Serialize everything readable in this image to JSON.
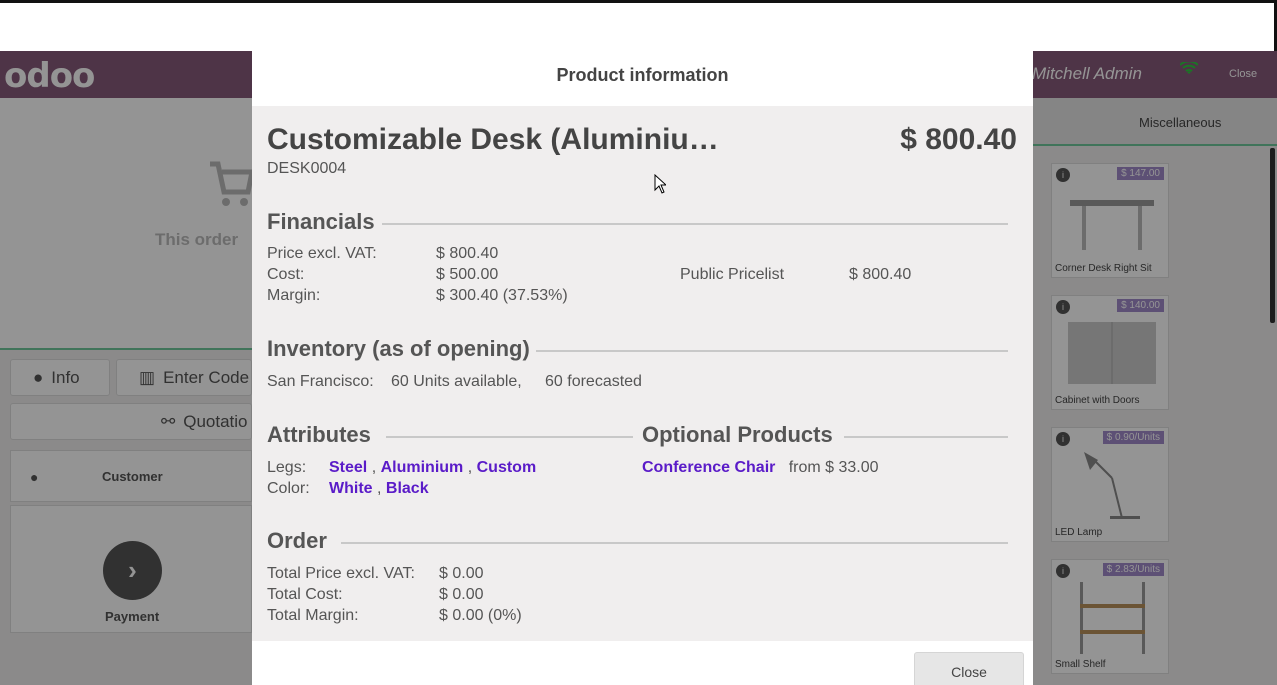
{
  "pos": {
    "logo": "odoo",
    "user": "Mitchell Admin",
    "close": "Close",
    "category": "Miscellaneous",
    "empty_cart": "This order",
    "info_button": "Info",
    "enter_code_button": "Enter Code",
    "quotation_button": "Quotatio",
    "customer_label": "Customer",
    "payment_label": "Payment",
    "products": [
      {
        "name": "Corner Desk Right Sit",
        "price": "$ 147.00"
      },
      {
        "name": "Cabinet with Doors",
        "price": "$ 140.00"
      },
      {
        "name": "LED Lamp",
        "price": "$ 0.90/Units"
      },
      {
        "name": "Small Shelf",
        "price": "$ 2.83/Units"
      }
    ]
  },
  "modal": {
    "title": "Product information",
    "product_name": "Customizable Desk (Aluminiu…",
    "product_price": "$ 800.40",
    "product_ref": "DESK0004",
    "financials": {
      "title": "Financials",
      "price_label": "Price excl. VAT:",
      "price_value": "$ 800.40",
      "cost_label": "Cost:",
      "cost_value": "$ 500.00",
      "margin_label": "Margin:",
      "margin_value": "$ 300.40 (37.53%)",
      "pricelist_name": "Public Pricelist",
      "pricelist_value": "$ 800.40"
    },
    "inventory": {
      "title": "Inventory (as of opening)",
      "warehouse": "San Francisco:",
      "available": "60 Units available,",
      "forecasted": "60 forecasted"
    },
    "attributes": {
      "title": "Attributes",
      "legs_label": "Legs:",
      "legs_values": [
        "Steel",
        "Aluminium",
        "Custom"
      ],
      "color_label": "Color:",
      "color_values": [
        "White",
        "Black"
      ]
    },
    "optional": {
      "title": "Optional Products",
      "product": "Conference Chair",
      "price": "from $ 33.00"
    },
    "order": {
      "title": "Order",
      "total_price_label": "Total Price excl. VAT:",
      "total_price_value": "$ 0.00",
      "total_cost_label": "Total Cost:",
      "total_cost_value": "$ 0.00",
      "total_margin_label": "Total Margin:",
      "total_margin_value": "$ 0.00 (0%)"
    },
    "close_button": "Close"
  }
}
